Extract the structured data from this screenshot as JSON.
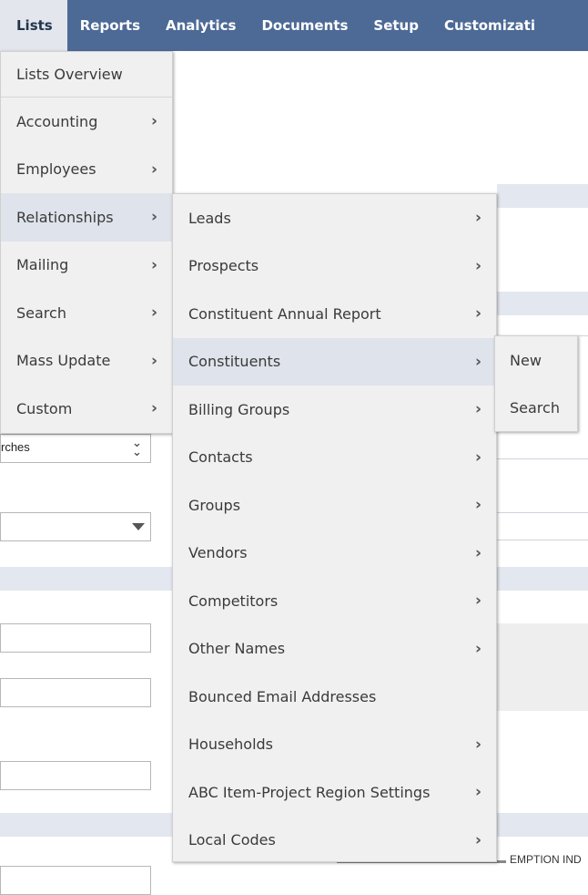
{
  "nav": {
    "tabs": [
      {
        "label": "Lists",
        "active": true
      },
      {
        "label": "Reports"
      },
      {
        "label": "Analytics"
      },
      {
        "label": "Documents"
      },
      {
        "label": "Setup"
      },
      {
        "label": "Customizati"
      }
    ]
  },
  "lists_menu": {
    "overview": "Lists Overview",
    "items": [
      {
        "label": "Accounting"
      },
      {
        "label": "Employees"
      },
      {
        "label": "Relationships",
        "active": true
      },
      {
        "label": "Mailing"
      },
      {
        "label": "Search"
      },
      {
        "label": "Mass Update"
      },
      {
        "label": "Custom"
      }
    ]
  },
  "relationships_menu": {
    "items": [
      {
        "label": "Leads",
        "has_submenu": true
      },
      {
        "label": "Prospects",
        "has_submenu": true
      },
      {
        "label": "Constituent Annual Report",
        "has_submenu": true
      },
      {
        "label": "Constituents",
        "has_submenu": true,
        "active": true
      },
      {
        "label": "Billing Groups",
        "has_submenu": true
      },
      {
        "label": "Contacts",
        "has_submenu": true
      },
      {
        "label": "Groups",
        "has_submenu": true
      },
      {
        "label": "Vendors",
        "has_submenu": true
      },
      {
        "label": "Competitors",
        "has_submenu": true
      },
      {
        "label": "Other Names",
        "has_submenu": true
      },
      {
        "label": "Bounced Email Addresses",
        "has_submenu": false
      },
      {
        "label": "Households",
        "has_submenu": true
      },
      {
        "label": "ABC Item-Project Region Settings",
        "has_submenu": true
      },
      {
        "label": "Local Codes",
        "has_submenu": true
      }
    ]
  },
  "constituents_menu": {
    "items": [
      {
        "label": "New"
      },
      {
        "label": "Search"
      }
    ]
  },
  "background": {
    "searches_field": "rches",
    "bottom_text": "EMPTION IND"
  },
  "colors": {
    "nav_bg": "#4d6a96",
    "menu_bg": "#f0f0f0",
    "menu_active": "#dfe3eb",
    "section_band": "#e3e7f0"
  },
  "icons": {
    "submenu_arrow": "chevron-right-icon",
    "dropdown": "caret-down-icon",
    "multi_select": "double-chevron-down-icon"
  }
}
